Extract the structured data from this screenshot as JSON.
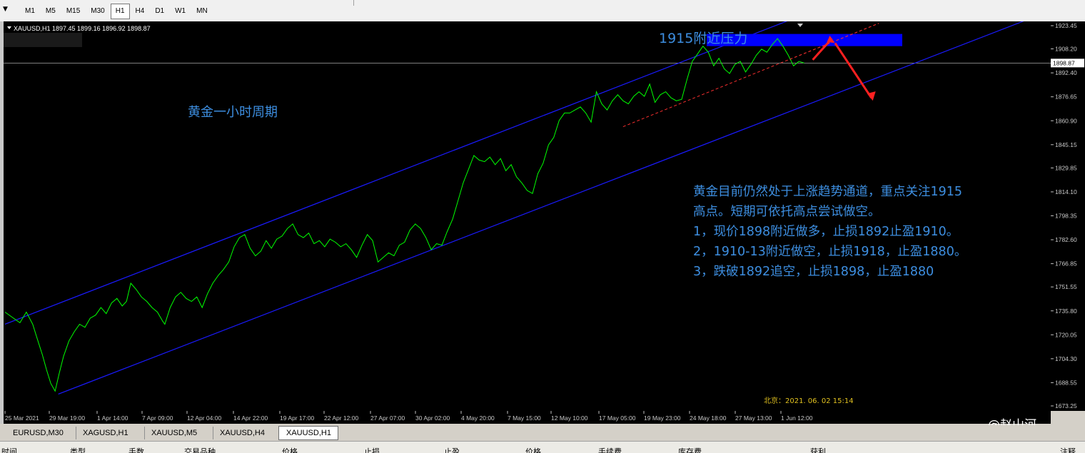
{
  "toolbar": {
    "timeframes": [
      "M1",
      "M5",
      "M15",
      "M30",
      "H1",
      "H4",
      "D1",
      "W1",
      "MN"
    ],
    "active_timeframe": "H1"
  },
  "chart_header": {
    "symbol_line": "XAUUSD,H1  1897.45 1899.16 1896.92 1898.87"
  },
  "annotations": {
    "resistance_label": "1915附近压力",
    "period_label": "黄金一小时周期",
    "analysis_lines": [
      "黄金目前仍然处于上涨趋势通道，重点关注1915",
      "高点。短期可依托高点尝试做空。",
      "1，现价1898附近做多，止损1892止盈1910。",
      "2，1910-13附近做空，止损1918，止盈1880。",
      "3，跌破1892追空，止损1898，止盈1880"
    ],
    "timestamp": "北京：2021. 06. 02  15:14"
  },
  "tabs": [
    "EURUSD,M30",
    "XAGUSD,H1",
    "XAUUSD,M5",
    "XAUUSD,H4",
    "XAUUSD,H1"
  ],
  "active_tab": "XAUUSD,H1",
  "bottom_columns": [
    "时间",
    "类型",
    "手数",
    "交易品种",
    "价格",
    "止损",
    "止盈",
    "价格",
    "手续费",
    "库存费",
    "获利",
    "注释"
  ],
  "watermark": "@赵山河",
  "colors": {
    "price_line": "#00ff00",
    "channel": "#1a1aff",
    "resistance_box": "#0000ff",
    "arrows": "#ff2020",
    "support_dash": "#ff3030",
    "annotation_text": "#3d8ee0",
    "timestamp_text": "#e0c020"
  },
  "chart_data": {
    "type": "line",
    "title": "XAUUSD,H1",
    "ylim": [
      1673.25,
      1923.45
    ],
    "current_price": 1898.87,
    "y_ticks": [
      1923.45,
      1908.2,
      1892.4,
      1876.65,
      1860.9,
      1845.15,
      1829.85,
      1814.1,
      1798.35,
      1782.6,
      1766.85,
      1751.55,
      1735.8,
      1720.05,
      1704.3,
      1688.55,
      1673.25
    ],
    "x_ticks": [
      "25 Mar 2021",
      "29 Mar 19:00",
      "1 Apr 14:00",
      "7 Apr 09:00",
      "12 Apr 04:00",
      "14 Apr 22:00",
      "19 Apr 17:00",
      "22 Apr 12:00",
      "27 Apr 07:00",
      "30 Apr 02:00",
      "4 May 20:00",
      "7 May 15:00",
      "12 May 10:00",
      "17 May 05:00",
      "19 May 23:00",
      "24 May 18:00",
      "27 May 13:00",
      "1 Jun 12:00"
    ],
    "series": [
      {
        "values": [
          [
            0,
            1735
          ],
          [
            0.8,
            1731
          ],
          [
            1.4,
            1728
          ],
          [
            2,
            1735
          ],
          [
            2.6,
            1727
          ],
          [
            3,
            1718
          ],
          [
            3.5,
            1707
          ],
          [
            3.9,
            1697
          ],
          [
            4.3,
            1688
          ],
          [
            4.7,
            1683
          ],
          [
            5.1,
            1695
          ],
          [
            5.5,
            1706
          ],
          [
            6,
            1716
          ],
          [
            6.5,
            1722
          ],
          [
            7,
            1727
          ],
          [
            7.5,
            1725
          ],
          [
            8,
            1731
          ],
          [
            8.5,
            1733
          ],
          [
            9,
            1738
          ],
          [
            9.5,
            1734
          ],
          [
            10,
            1741
          ],
          [
            10.5,
            1744
          ],
          [
            11,
            1739
          ],
          [
            11.4,
            1742
          ],
          [
            11.8,
            1754
          ],
          [
            12.3,
            1750
          ],
          [
            12.8,
            1745
          ],
          [
            13.3,
            1742
          ],
          [
            13.8,
            1738
          ],
          [
            14.3,
            1735
          ],
          [
            14.8,
            1729
          ],
          [
            15,
            1727
          ],
          [
            15.5,
            1738
          ],
          [
            16,
            1745
          ],
          [
            16.5,
            1748
          ],
          [
            17,
            1744
          ],
          [
            17.5,
            1742
          ],
          [
            18,
            1745
          ],
          [
            18.5,
            1738
          ],
          [
            19,
            1747
          ],
          [
            19.5,
            1754
          ],
          [
            20,
            1759
          ],
          [
            20.5,
            1763
          ],
          [
            21,
            1768
          ],
          [
            21.5,
            1778
          ],
          [
            22,
            1784
          ],
          [
            22.5,
            1786
          ],
          [
            23,
            1777
          ],
          [
            23.5,
            1772
          ],
          [
            24,
            1775
          ],
          [
            24.5,
            1782
          ],
          [
            25,
            1777
          ],
          [
            25.5,
            1783
          ],
          [
            26,
            1785
          ],
          [
            26.5,
            1790
          ],
          [
            27,
            1793
          ],
          [
            27.5,
            1786
          ],
          [
            28,
            1784
          ],
          [
            28.5,
            1787
          ],
          [
            29,
            1780
          ],
          [
            29.5,
            1782
          ],
          [
            30,
            1778
          ],
          [
            30.5,
            1783
          ],
          [
            31,
            1781
          ],
          [
            31.5,
            1778
          ],
          [
            32,
            1780
          ],
          [
            32.5,
            1776
          ],
          [
            33,
            1771
          ],
          [
            33.5,
            1779
          ],
          [
            34,
            1786
          ],
          [
            34.5,
            1782
          ],
          [
            35,
            1768
          ],
          [
            35.5,
            1771
          ],
          [
            36,
            1774
          ],
          [
            36.5,
            1772
          ],
          [
            37,
            1779
          ],
          [
            37.5,
            1781
          ],
          [
            38,
            1789
          ],
          [
            38.5,
            1793
          ],
          [
            39,
            1790
          ],
          [
            39.5,
            1784
          ],
          [
            40,
            1776
          ],
          [
            40.5,
            1780
          ],
          [
            41,
            1779
          ],
          [
            41.5,
            1788
          ],
          [
            42,
            1796
          ],
          [
            42.5,
            1808
          ],
          [
            43,
            1820
          ],
          [
            43.5,
            1829
          ],
          [
            44,
            1838
          ],
          [
            44.5,
            1835
          ],
          [
            45,
            1834
          ],
          [
            45.5,
            1837
          ],
          [
            46,
            1832
          ],
          [
            46.5,
            1836
          ],
          [
            47,
            1828
          ],
          [
            47.5,
            1832
          ],
          [
            48,
            1824
          ],
          [
            48.5,
            1820
          ],
          [
            49,
            1815
          ],
          [
            49.5,
            1813
          ],
          [
            50,
            1826
          ],
          [
            50.5,
            1833
          ],
          [
            51,
            1845
          ],
          [
            51.5,
            1850
          ],
          [
            52,
            1861
          ],
          [
            52.5,
            1866
          ],
          [
            53,
            1866
          ],
          [
            53.5,
            1868
          ],
          [
            54,
            1870
          ],
          [
            54.5,
            1866
          ],
          [
            55,
            1860
          ],
          [
            55.5,
            1880
          ],
          [
            56,
            1872
          ],
          [
            56.5,
            1868
          ],
          [
            57,
            1874
          ],
          [
            57.5,
            1878
          ],
          [
            58,
            1874
          ],
          [
            58.5,
            1872
          ],
          [
            59,
            1877
          ],
          [
            59.5,
            1880
          ],
          [
            60,
            1877
          ],
          [
            60.5,
            1885
          ],
          [
            61,
            1873
          ],
          [
            61.5,
            1878
          ],
          [
            62,
            1880
          ],
          [
            62.5,
            1876
          ],
          [
            63,
            1874
          ],
          [
            63.5,
            1875
          ],
          [
            64,
            1888
          ],
          [
            64.5,
            1900
          ],
          [
            65,
            1905
          ],
          [
            65.5,
            1910
          ],
          [
            66,
            1906
          ],
          [
            66.5,
            1897
          ],
          [
            67,
            1902
          ],
          [
            67.5,
            1895
          ],
          [
            68,
            1892
          ],
          [
            68.5,
            1898
          ],
          [
            69,
            1900
          ],
          [
            69.5,
            1893
          ],
          [
            70,
            1898
          ],
          [
            70.5,
            1904
          ],
          [
            71,
            1908
          ],
          [
            71.5,
            1906
          ],
          [
            72,
            1911
          ],
          [
            72.5,
            1915
          ],
          [
            73,
            1910
          ],
          [
            73.5,
            1904
          ],
          [
            74,
            1897
          ],
          [
            74.5,
            1900
          ],
          [
            75,
            1898.87
          ]
        ]
      }
    ],
    "channel_lines": [
      {
        "name": "upper",
        "from": [
          0,
          1727
        ],
        "to": [
          78,
          1939
        ]
      },
      {
        "name": "lower",
        "from": [
          5,
          1681
        ],
        "to": [
          98,
          1933
        ]
      }
    ],
    "resistance_zone": [
      1910,
      1918
    ],
    "support_trendline": {
      "from": [
        58,
        1857
      ],
      "to": [
        82,
        1925
      ]
    },
    "x_max": 98
  }
}
